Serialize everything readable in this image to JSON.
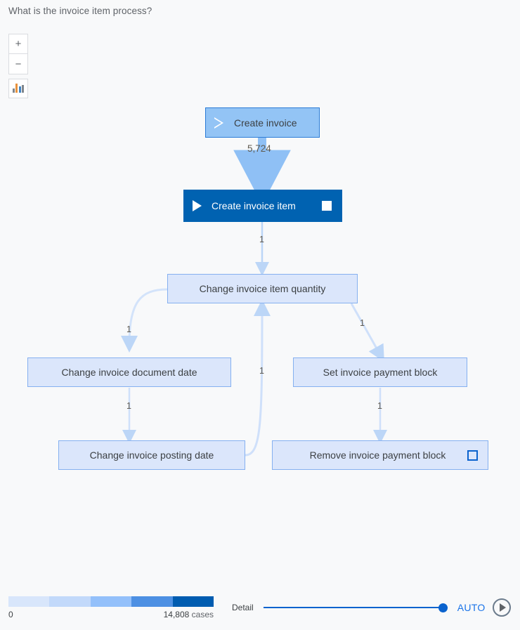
{
  "header": {
    "question": "What is the invoice item process?"
  },
  "controls": {
    "zoom_in_label": "+",
    "zoom_out_label": "−",
    "chart_icon": "bar-chart-icon"
  },
  "graph": {
    "nodes": [
      {
        "id": "create-invoice",
        "label": "Create invoice",
        "style": "start",
        "start_marker": true,
        "end_marker": false
      },
      {
        "id": "create-invoice-item",
        "label": "Create invoice item",
        "style": "dark",
        "start_marker": true,
        "end_marker": true
      },
      {
        "id": "change-invoice-item-quantity",
        "label": "Change invoice item quantity",
        "style": "plain",
        "start_marker": false,
        "end_marker": false
      },
      {
        "id": "change-invoice-document-date",
        "label": "Change invoice document date",
        "style": "plain",
        "start_marker": false,
        "end_marker": false
      },
      {
        "id": "set-invoice-payment-block",
        "label": "Set invoice payment block",
        "style": "plain",
        "start_marker": false,
        "end_marker": false
      },
      {
        "id": "change-invoice-posting-date",
        "label": "Change invoice posting date",
        "style": "plain",
        "start_marker": false,
        "end_marker": false
      },
      {
        "id": "remove-invoice-payment-block",
        "label": "Remove invoice payment block",
        "style": "plain",
        "start_marker": false,
        "end_marker": true
      }
    ],
    "edge_labels": {
      "create_to_item": "5,724",
      "item_to_quantity": "1",
      "quantity_to_document_date": "1",
      "quantity_to_payment_block": "1",
      "document_date_to_posting_date": "1",
      "payment_block_to_remove": "1",
      "posting_date_to_quantity": "1"
    }
  },
  "legend": {
    "min_label": "0",
    "max_value": "14,808",
    "max_unit": "cases",
    "colors": [
      "#d8e6fb",
      "#c2d9fa",
      "#93c0fa",
      "#4d90e3",
      "#005cb0"
    ]
  },
  "footer": {
    "detail_label": "Detail",
    "auto_label": "AUTO",
    "play_icon": "play-icon",
    "slider_value": 100
  }
}
